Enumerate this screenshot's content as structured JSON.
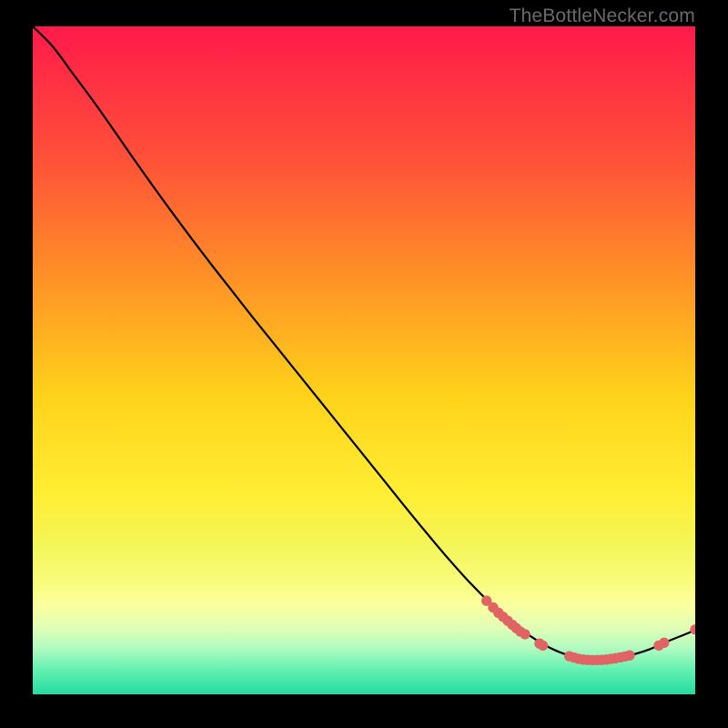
{
  "watermark": "TheBottleNecker.com",
  "chart_data": {
    "type": "line",
    "title": "",
    "xlabel": "",
    "ylabel": "",
    "xlim": [
      0,
      100
    ],
    "ylim": [
      0,
      100
    ],
    "background_gradient": {
      "stops": [
        {
          "offset": 0.0,
          "color": "#ff1a4a"
        },
        {
          "offset": 0.2,
          "color": "#ff5138"
        },
        {
          "offset": 0.4,
          "color": "#ff9a24"
        },
        {
          "offset": 0.55,
          "color": "#ffd21a"
        },
        {
          "offset": 0.7,
          "color": "#ffee33"
        },
        {
          "offset": 0.78,
          "color": "#f3f65a"
        },
        {
          "offset": 0.83,
          "color": "#f8fc7a"
        },
        {
          "offset": 0.865,
          "color": "#fbff9c"
        },
        {
          "offset": 0.9,
          "color": "#e1feb6"
        },
        {
          "offset": 0.93,
          "color": "#b3fbc0"
        },
        {
          "offset": 0.965,
          "color": "#5ff0b0"
        },
        {
          "offset": 1.0,
          "color": "#24dba0"
        }
      ]
    },
    "curve": {
      "comment": "x,y in percent of plot area, origin at top-left of plot rect",
      "points": [
        [
          0,
          0
        ],
        [
          3,
          3
        ],
        [
          6,
          7
        ],
        [
          9,
          11
        ],
        [
          12,
          15.2
        ],
        [
          15,
          19.5
        ],
        [
          18,
          23.7
        ],
        [
          21,
          27.8
        ],
        [
          24,
          31.8
        ],
        [
          27,
          35.7
        ],
        [
          30,
          39.5
        ],
        [
          33,
          43.3
        ],
        [
          36,
          47.0
        ],
        [
          39,
          50.7
        ],
        [
          42,
          54.4
        ],
        [
          45,
          58.1
        ],
        [
          48,
          61.8
        ],
        [
          51,
          65.5
        ],
        [
          54,
          69.2
        ],
        [
          57,
          72.9
        ],
        [
          60,
          76.5
        ],
        [
          63,
          80.0
        ],
        [
          66,
          83.3
        ],
        [
          69,
          86.3
        ],
        [
          72,
          89.0
        ],
        [
          75,
          91.2
        ],
        [
          78,
          93.0
        ],
        [
          81,
          94.2
        ],
        [
          84,
          94.8
        ],
        [
          87,
          94.8
        ],
        [
          90,
          94.2
        ],
        [
          93,
          93.3
        ],
        [
          96,
          92.0
        ],
        [
          99,
          90.8
        ],
        [
          100,
          90.3
        ]
      ]
    },
    "markers": {
      "color": "#e06464",
      "radius_pct": 0.78,
      "points_xy_pct": [
        [
          68.5,
          86.0
        ],
        [
          69.5,
          87.0
        ],
        [
          70.3,
          87.8
        ],
        [
          71.0,
          88.4
        ],
        [
          71.7,
          89.0
        ],
        [
          72.4,
          89.6
        ],
        [
          73.0,
          90.1
        ],
        [
          73.6,
          90.6
        ],
        [
          74.3,
          91.0
        ],
        [
          76.5,
          92.4
        ],
        [
          77.0,
          92.7
        ],
        [
          81.0,
          94.3
        ],
        [
          81.7,
          94.5
        ],
        [
          82.4,
          94.7
        ],
        [
          83.1,
          94.8
        ],
        [
          83.8,
          94.85
        ],
        [
          84.5,
          94.88
        ],
        [
          85.2,
          94.88
        ],
        [
          85.9,
          94.85
        ],
        [
          86.6,
          94.8
        ],
        [
          87.3,
          94.7
        ],
        [
          88.0,
          94.6
        ],
        [
          88.7,
          94.48
        ],
        [
          89.4,
          94.33
        ],
        [
          90.1,
          94.17
        ],
        [
          94.5,
          92.7
        ],
        [
          95.3,
          92.28
        ],
        [
          100.0,
          90.3
        ]
      ]
    }
  }
}
